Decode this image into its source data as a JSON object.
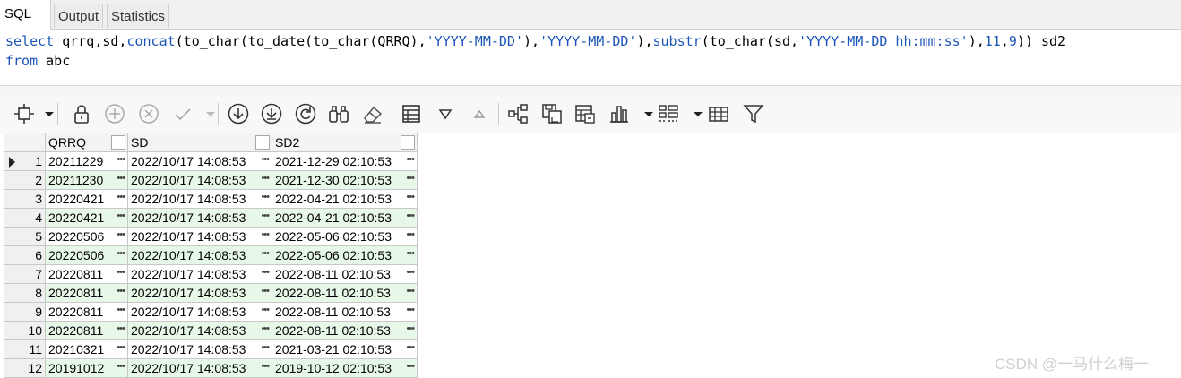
{
  "tabs": [
    "SQL",
    "Output",
    "Statistics"
  ],
  "sql": {
    "line1": [
      {
        "t": "select",
        "c": "kw"
      },
      {
        "t": " qrrq,sd,",
        "c": "txt"
      },
      {
        "t": "concat",
        "c": "kw"
      },
      {
        "t": "(to_char(to_date(to_char(QRRQ),",
        "c": "txt"
      },
      {
        "t": "'YYYY-MM-DD'",
        "c": "str"
      },
      {
        "t": "),",
        "c": "txt"
      },
      {
        "t": "'YYYY-MM-DD'",
        "c": "str"
      },
      {
        "t": "),",
        "c": "txt"
      },
      {
        "t": "substr",
        "c": "kw"
      },
      {
        "t": "(to_char(sd,",
        "c": "txt"
      },
      {
        "t": "'YYYY-MM-DD hh:mm:ss'",
        "c": "str"
      },
      {
        "t": "),",
        "c": "txt"
      },
      {
        "t": "11",
        "c": "str"
      },
      {
        "t": ",",
        "c": "txt"
      },
      {
        "t": "9",
        "c": "str"
      },
      {
        "t": ")) sd2",
        "c": "txt"
      }
    ],
    "line2": [
      {
        "t": "from",
        "c": "kw"
      },
      {
        "t": " abc",
        "c": "txt"
      }
    ]
  },
  "toolbar": {
    "icons": [
      "select-grid-icon",
      "dropdown-arrow-icon",
      "lock-icon",
      "add-record-icon",
      "delete-record-icon",
      "post-changes-icon",
      "dropdown-arrow-icon",
      "fetch-next-page-icon",
      "fetch-last-page-icon",
      "refresh-icon",
      "find-icon",
      "clear-icon",
      "single-record-view-icon",
      "query-by-example-icon",
      "sort-up-icon",
      "export-icon",
      "save-icon",
      "print-icon",
      "chart-icon",
      "dropdown-arrow-icon",
      "layout-icon",
      "dropdown-arrow-icon",
      "table-view-icon",
      "filter-icon"
    ]
  },
  "grid": {
    "columns": [
      "QRRQ",
      "SD",
      "SD2"
    ],
    "rows": [
      {
        "n": "1",
        "qrrq": "20211229",
        "sd": "2022/10/17 14:08:53",
        "sd2": "2021-12-29 02:10:53"
      },
      {
        "n": "2",
        "qrrq": "20211230",
        "sd": "2022/10/17 14:08:53",
        "sd2": "2021-12-30 02:10:53"
      },
      {
        "n": "3",
        "qrrq": "20220421",
        "sd": "2022/10/17 14:08:53",
        "sd2": "2022-04-21 02:10:53"
      },
      {
        "n": "4",
        "qrrq": "20220421",
        "sd": "2022/10/17 14:08:53",
        "sd2": "2022-04-21 02:10:53"
      },
      {
        "n": "5",
        "qrrq": "20220506",
        "sd": "2022/10/17 14:08:53",
        "sd2": "2022-05-06 02:10:53"
      },
      {
        "n": "6",
        "qrrq": "20220506",
        "sd": "2022/10/17 14:08:53",
        "sd2": "2022-05-06 02:10:53"
      },
      {
        "n": "7",
        "qrrq": "20220811",
        "sd": "2022/10/17 14:08:53",
        "sd2": "2022-08-11 02:10:53"
      },
      {
        "n": "8",
        "qrrq": "20220811",
        "sd": "2022/10/17 14:08:53",
        "sd2": "2022-08-11 02:10:53"
      },
      {
        "n": "9",
        "qrrq": "20220811",
        "sd": "2022/10/17 14:08:53",
        "sd2": "2022-08-11 02:10:53"
      },
      {
        "n": "10",
        "qrrq": "20220811",
        "sd": "2022/10/17 14:08:53",
        "sd2": "2022-08-11 02:10:53"
      },
      {
        "n": "11",
        "qrrq": "20210321",
        "sd": "2022/10/17 14:08:53",
        "sd2": "2021-03-21 02:10:53"
      },
      {
        "n": "12",
        "qrrq": "20191012",
        "sd": "2022/10/17 14:08:53",
        "sd2": "2019-10-12 02:10:53"
      }
    ]
  },
  "watermark": "CSDN @一马什么梅一",
  "colors": {
    "keyword": "#1d56b8",
    "even_row": "#e8f8e8",
    "grid_border": "#c8c8c8"
  }
}
